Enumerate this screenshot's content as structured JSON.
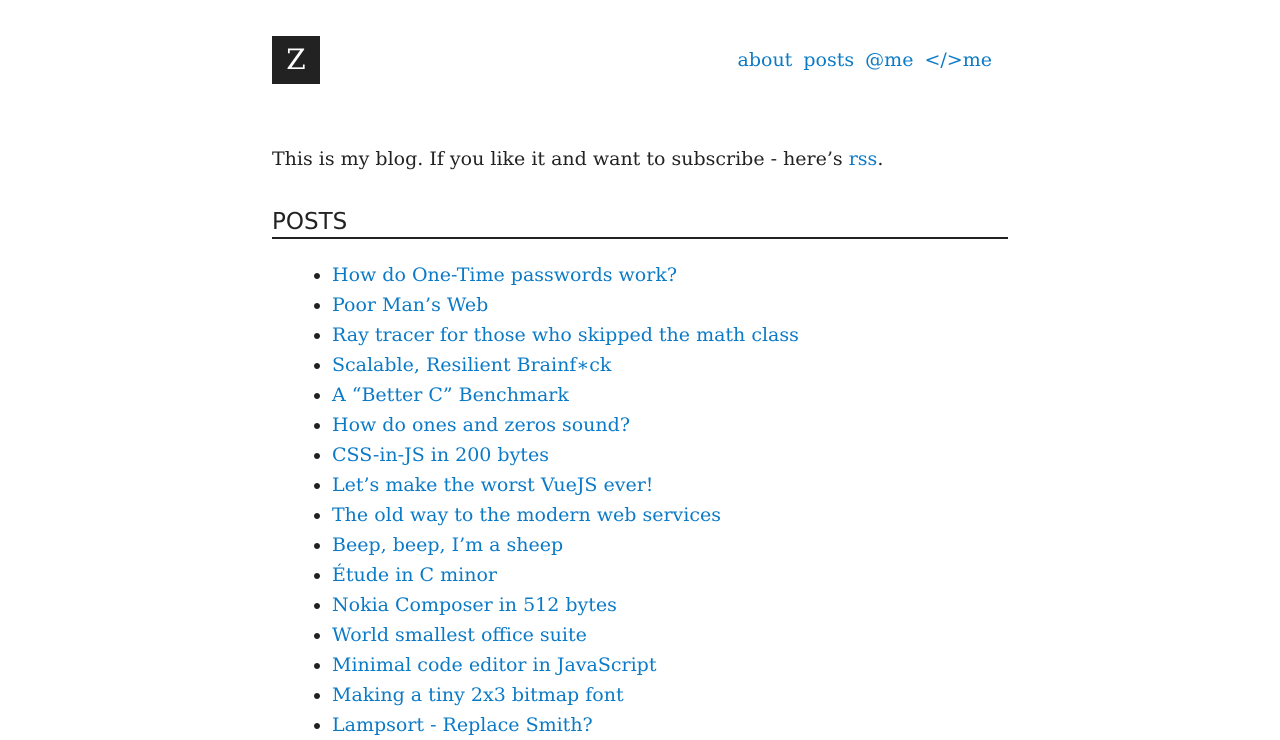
{
  "header": {
    "logo_letter": "Z",
    "nav": [
      {
        "label": "about"
      },
      {
        "label": "posts"
      },
      {
        "label": "@me"
      },
      {
        "label": "</>me"
      }
    ]
  },
  "intro": {
    "text_before": "This is my blog. If you like it and want to subscribe - here’s ",
    "link_label": "rss",
    "text_after": "."
  },
  "posts": {
    "title": "POSTS",
    "items": [
      "How do One-Time passwords work?",
      "Poor Man’s Web",
      "Ray tracer for those who skipped the math class",
      "Scalable, Resilient Brainf∗ck",
      "A “Better C” Benchmark",
      "How do ones and zeros sound?",
      "CSS-in-JS in 200 bytes",
      "Let’s make the worst VueJS ever!",
      "The old way to the modern web services",
      "Beep, beep, I’m a sheep",
      "Étude in C minor",
      "Nokia Composer in 512 bytes",
      "World smallest office suite",
      "Minimal code editor in JavaScript",
      "Making a tiny 2x3 bitmap font",
      "Lampsort - Replace Smith?"
    ]
  },
  "colors": {
    "link": "#0b7ac6",
    "text": "#222222",
    "logo_bg": "#222222"
  }
}
